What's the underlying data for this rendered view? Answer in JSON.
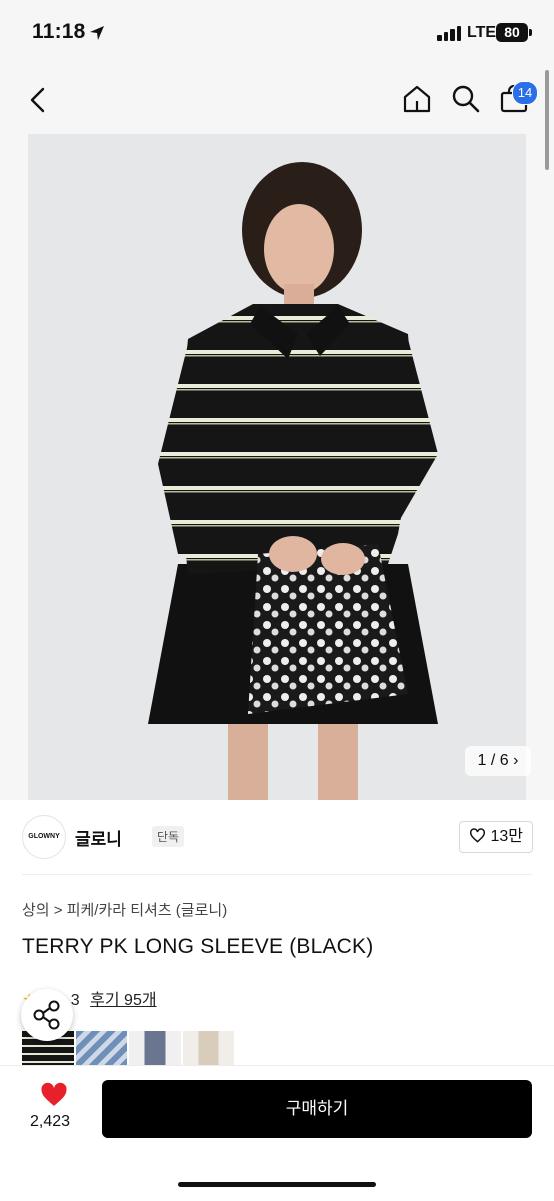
{
  "status_bar": {
    "time": "11:18",
    "network": "LTE",
    "battery": "80"
  },
  "nav": {
    "cart_count": "14"
  },
  "gallery": {
    "counter": "1 / 6 ›"
  },
  "brand": {
    "logo_text": "GLOWNY",
    "name": "글로니",
    "tag": "단독",
    "likes": "13만"
  },
  "product": {
    "breadcrumb": "상의 > 피케/카라 티셔츠 (글로니)",
    "title": "TERRY PK LONG SLEEVE (BLACK)",
    "rating_partial": "3",
    "reviews": "후기 95개"
  },
  "bottom": {
    "heart_count": "2,423",
    "buy_label": "구매하기",
    "heart_color": "#e8202a"
  }
}
